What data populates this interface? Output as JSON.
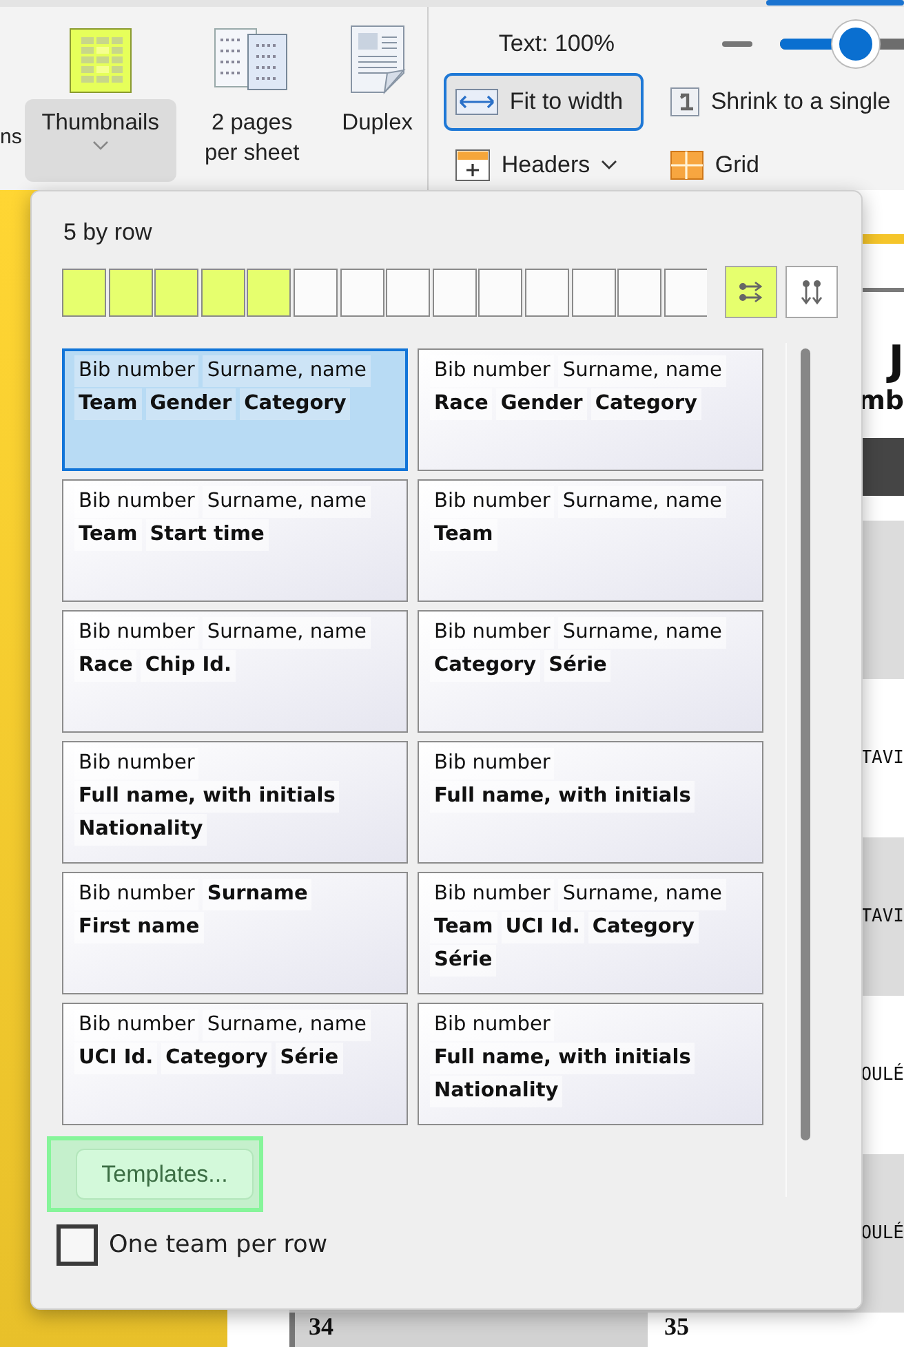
{
  "ribbon": {
    "cut_label": "ns",
    "large_buttons": [
      {
        "label": "Thumbnails",
        "selected": true,
        "has_menu": true
      },
      {
        "label": "2 pages per sheet",
        "selected": false,
        "has_menu": false
      },
      {
        "label": "Duplex",
        "selected": false,
        "has_menu": false
      }
    ],
    "text_size": {
      "label": "Text: 100%",
      "level": 0.5
    },
    "view_buttons": [
      {
        "label": "Fit to width",
        "selected": true,
        "has_menu": false
      },
      {
        "label": "Shrink to a single",
        "selected": false,
        "has_menu": false
      },
      {
        "label": "Headers",
        "selected": false,
        "has_menu": true
      },
      {
        "label": "Grid",
        "selected": false,
        "has_menu": false
      }
    ]
  },
  "document": {
    "title": "J",
    "subtitle": "mb",
    "rows": [
      {},
      {
        "column_2": "TAVI"
      },
      {
        "column_2": "TAVI"
      },
      {
        "column_2": "OULÉ"
      },
      {
        "column_2": "OULÉ"
      },
      {
        "column_1": "34",
        "column_2": "35"
      }
    ]
  },
  "popup": {
    "row_count_label": "5 by row",
    "count_cells": [
      {
        "on": true
      },
      {
        "on": true
      },
      {
        "on": true
      },
      {
        "on": true
      },
      {
        "on": true
      },
      {
        "on": false
      },
      {
        "on": false
      },
      {
        "on": false
      },
      {
        "on": false
      },
      {
        "on": false
      },
      {
        "on": false
      },
      {
        "on": false
      },
      {
        "on": false
      },
      {
        "on": false
      }
    ],
    "orientation_buttons": [
      {
        "selected": true
      },
      {
        "selected": false
      }
    ],
    "templates": [
      {
        "selected": true,
        "lines": [
          [
            {
              "text": "Bib number",
              "bold": false
            },
            {
              "text": "Surname, name",
              "bold": false
            }
          ],
          [
            {
              "text": "Team",
              "bold": true
            },
            {
              "text": "Gender",
              "bold": true
            },
            {
              "text": "Category",
              "bold": true
            }
          ]
        ]
      },
      {
        "selected": false,
        "lines": [
          [
            {
              "text": "Bib number",
              "bold": false
            },
            {
              "text": "Surname, name",
              "bold": false
            }
          ],
          [
            {
              "text": "Race",
              "bold": true
            },
            {
              "text": "Gender",
              "bold": true
            },
            {
              "text": "Category",
              "bold": true
            }
          ]
        ]
      },
      {
        "selected": false,
        "lines": [
          [
            {
              "text": "Bib number",
              "bold": false
            },
            {
              "text": "Surname, name",
              "bold": false
            }
          ],
          [
            {
              "text": "Team",
              "bold": true
            },
            {
              "text": "Start time",
              "bold": true
            }
          ]
        ]
      },
      {
        "selected": false,
        "lines": [
          [
            {
              "text": "Bib number",
              "bold": false
            },
            {
              "text": "Surname, name",
              "bold": false
            }
          ],
          [
            {
              "text": "Team",
              "bold": true
            }
          ]
        ]
      },
      {
        "selected": false,
        "lines": [
          [
            {
              "text": "Bib number",
              "bold": false
            },
            {
              "text": "Surname, name",
              "bold": false
            }
          ],
          [
            {
              "text": "Race",
              "bold": true
            },
            {
              "text": "Chip Id.",
              "bold": true
            }
          ]
        ]
      },
      {
        "selected": false,
        "lines": [
          [
            {
              "text": "Bib number",
              "bold": false
            },
            {
              "text": "Surname, name",
              "bold": false
            }
          ],
          [
            {
              "text": "Category",
              "bold": true
            },
            {
              "text": "Série",
              "bold": true
            }
          ]
        ]
      },
      {
        "selected": false,
        "lines": [
          [
            {
              "text": "Bib number",
              "bold": false
            }
          ],
          [
            {
              "text": "Full name, with initials",
              "bold": true
            }
          ],
          [
            {
              "text": "Nationality",
              "bold": true
            }
          ]
        ]
      },
      {
        "selected": false,
        "lines": [
          [
            {
              "text": "Bib number",
              "bold": false
            }
          ],
          [
            {
              "text": "Full name, with initials",
              "bold": true
            }
          ]
        ]
      },
      {
        "selected": false,
        "lines": [
          [
            {
              "text": "Bib number",
              "bold": false
            },
            {
              "text": "Surname",
              "bold": true
            }
          ],
          [
            {
              "text": "First name",
              "bold": true
            }
          ]
        ]
      },
      {
        "selected": false,
        "lines": [
          [
            {
              "text": "Bib number",
              "bold": false
            },
            {
              "text": "Surname, name",
              "bold": false
            }
          ],
          [
            {
              "text": "Team",
              "bold": true
            },
            {
              "text": "UCI Id.",
              "bold": true
            },
            {
              "text": "Category",
              "bold": true
            }
          ],
          [
            {
              "text": "Série",
              "bold": true
            }
          ]
        ]
      },
      {
        "selected": false,
        "lines": [
          [
            {
              "text": "Bib number",
              "bold": false
            },
            {
              "text": "Surname, name",
              "bold": false
            }
          ],
          [
            {
              "text": "UCI Id.",
              "bold": true
            },
            {
              "text": "Category",
              "bold": true
            },
            {
              "text": "Série",
              "bold": true
            }
          ]
        ]
      },
      {
        "selected": false,
        "lines": [
          [
            {
              "text": "Bib number",
              "bold": false
            }
          ],
          [
            {
              "text": "Full name, with initials",
              "bold": true
            }
          ],
          [
            {
              "text": "Nationality",
              "bold": true
            }
          ]
        ]
      }
    ],
    "templates_button": {
      "label": "Templates...",
      "highlighted": true
    },
    "one_team_per_row": {
      "label": "One team per row",
      "checked": false
    }
  }
}
